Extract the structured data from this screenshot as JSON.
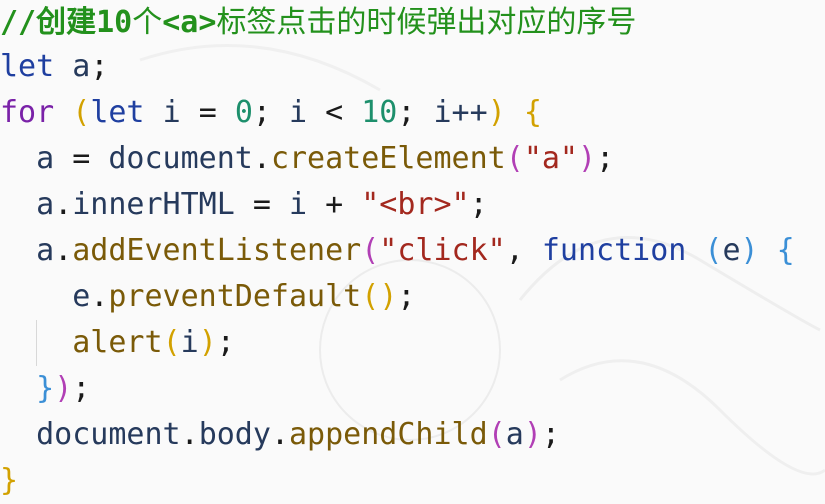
{
  "code": {
    "comment_prefix": "//创建",
    "comment_num": "10",
    "comment_mid": "个",
    "comment_tag": "<a>",
    "comment_rest": "标签点击的时候弹出对应的序号",
    "l2_kw": "let",
    "l2_ident": "a",
    "l2_end": ";",
    "l3_kw": "for",
    "l3_open": "(",
    "l3_let": "let",
    "l3_i": "i",
    "l3_eq": "=",
    "l3_zero": "0",
    "l3_semi1": ";",
    "l3_i2": "i",
    "l3_lt": "<",
    "l3_ten": "10",
    "l3_semi2": ";",
    "l3_inc": "i++",
    "l3_close": ")",
    "l3_brace": "{",
    "l4_a": "a",
    "l4_eq": "=",
    "l4_obj": "document",
    "l4_dot": ".",
    "l4_fn": "createElement",
    "l4_open": "(",
    "l4_str": "\"a\"",
    "l4_close": ")",
    "l4_end": ";",
    "l5_a": "a",
    "l5_dot": ".",
    "l5_prop": "innerHTML",
    "l5_eq": "=",
    "l5_i": "i",
    "l5_plus": "+",
    "l5_str": "\"<br>\"",
    "l5_end": ";",
    "l6_a": "a",
    "l6_dot": ".",
    "l6_fn": "addEventListener",
    "l6_open": "(",
    "l6_str": "\"click\"",
    "l6_comma": ",",
    "l6_kw": "function",
    "l6_popen": "(",
    "l6_e": "e",
    "l6_pclose": ")",
    "l6_brace": "{",
    "l7_e": "e",
    "l7_dot": ".",
    "l7_fn": "preventDefault",
    "l7_open": "(",
    "l7_close": ")",
    "l7_end": ";",
    "l8_fn": "alert",
    "l8_open": "(",
    "l8_i": "i",
    "l8_close": ")",
    "l8_end": ";",
    "l9_brace": "}",
    "l9_close": ")",
    "l9_end": ";",
    "l10_obj": "document",
    "l10_dot1": ".",
    "l10_prop": "body",
    "l10_dot2": ".",
    "l10_fn": "appendChild",
    "l10_open": "(",
    "l10_a": "a",
    "l10_close": ")",
    "l10_end": ";",
    "l11_brace": "}"
  }
}
